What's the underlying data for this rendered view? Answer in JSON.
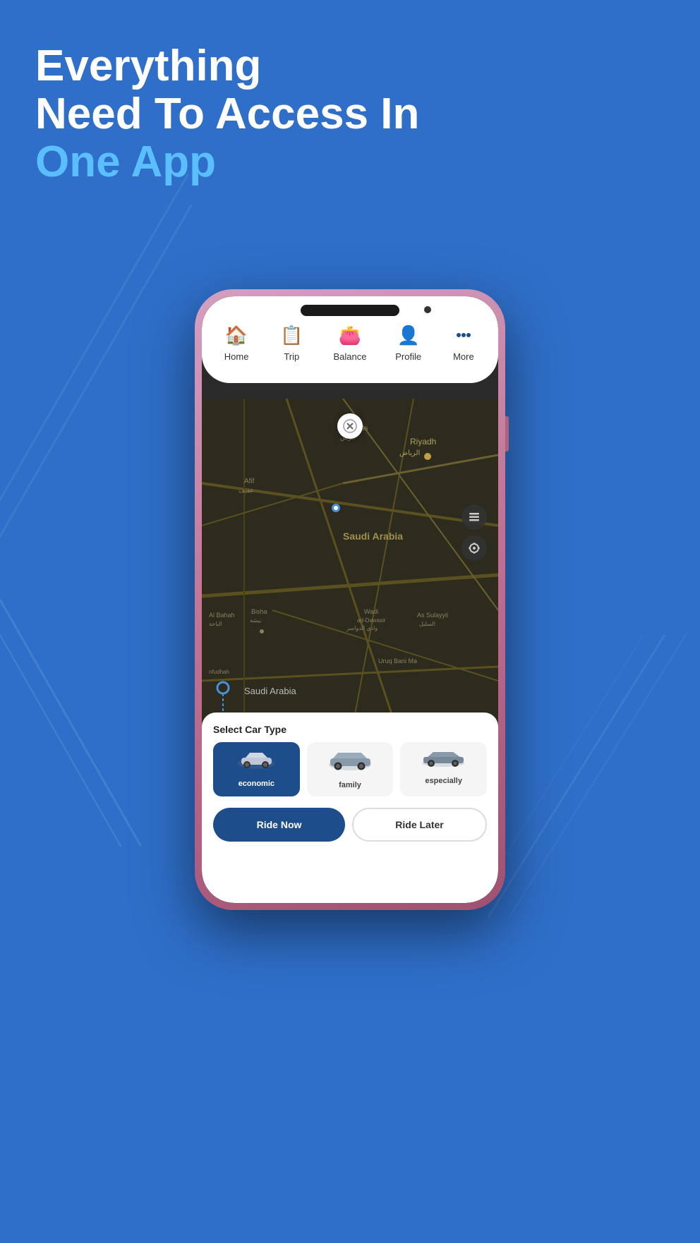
{
  "headline": {
    "line1": "Everything",
    "line2": "Need To Access In",
    "line3": "One App"
  },
  "nav": {
    "items": [
      {
        "id": "home",
        "label": "Home",
        "icon": "🏠"
      },
      {
        "id": "trip",
        "label": "Trip",
        "icon": "📋"
      },
      {
        "id": "balance",
        "label": "Balance",
        "icon": "👛"
      },
      {
        "id": "profile",
        "label": "Profile",
        "icon": "👤"
      },
      {
        "id": "more",
        "label": "More",
        "icon": "⋯"
      }
    ]
  },
  "map": {
    "location_label": "Saudi Arabia"
  },
  "car_section": {
    "title": "Select Car Type",
    "options": [
      {
        "id": "economic",
        "name": "economic",
        "selected": true
      },
      {
        "id": "family",
        "name": "family",
        "selected": false
      },
      {
        "id": "especially",
        "name": "especially",
        "selected": false
      }
    ]
  },
  "buttons": {
    "ride_now": "Ride Now",
    "ride_later": "Ride Later"
  },
  "colors": {
    "accent_blue": "#2f6fc9",
    "light_blue": "#5bbfff",
    "navy": "#1e4d8c"
  }
}
